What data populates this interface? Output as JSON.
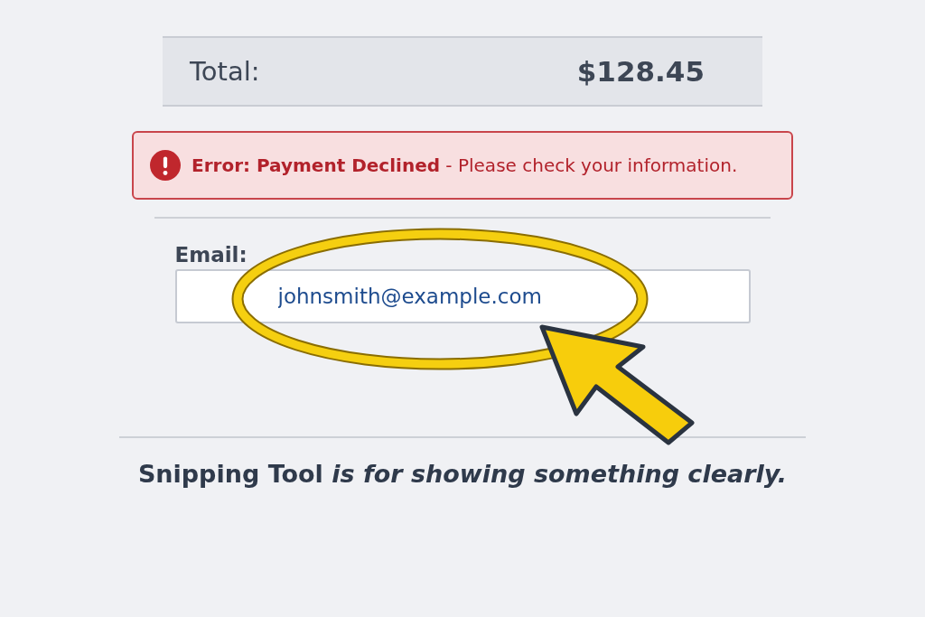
{
  "total": {
    "label": "Total:",
    "amount": "$128.45"
  },
  "error": {
    "message": "**Error: Payment Declined** - Please check your information."
  },
  "email": {
    "label": "Email:",
    "value": "johnsmith@example.com",
    "highlighted": true
  },
  "caption": "Snipping Tool *is for showing something clearly.*"
}
